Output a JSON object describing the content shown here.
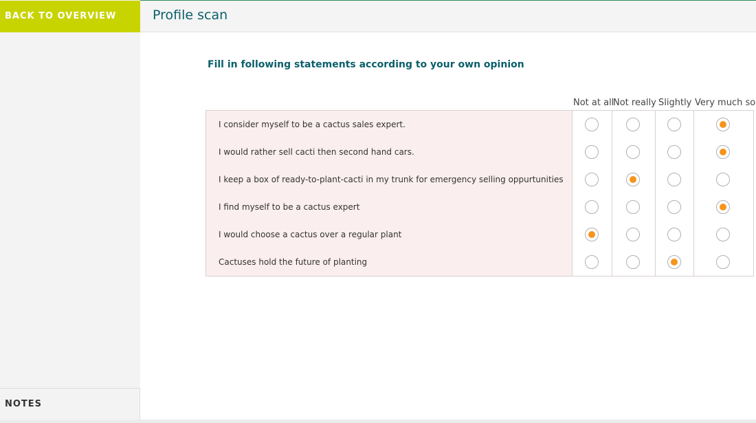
{
  "sidebar": {
    "back_label": "BACK TO OVERVIEW",
    "notes_label": "NOTES"
  },
  "header": {
    "title": "Profile scan"
  },
  "survey": {
    "instructions": "Fill in following statements according to your own opinion",
    "columns": [
      "Not at all",
      "Not really",
      "Slightly",
      "Very much so"
    ],
    "statements": [
      {
        "text": "I consider myself to be a cactus sales expert.",
        "selected": 3
      },
      {
        "text": "I would rather sell cacti then second hand cars.",
        "selected": 3
      },
      {
        "text": "I keep a box of ready-to-plant-cacti in my trunk for emergency selling oppurtunities",
        "selected": 1
      },
      {
        "text": "I find myself to be a cactus expert",
        "selected": 3
      },
      {
        "text": "I would choose a cactus over a regular plant",
        "selected": 0
      },
      {
        "text": "Cactuses hold the future of planting",
        "selected": 2
      }
    ]
  },
  "colors": {
    "accent": "#c8d400",
    "radio_selected": "#f7941d",
    "title": "#0b5f6a"
  }
}
